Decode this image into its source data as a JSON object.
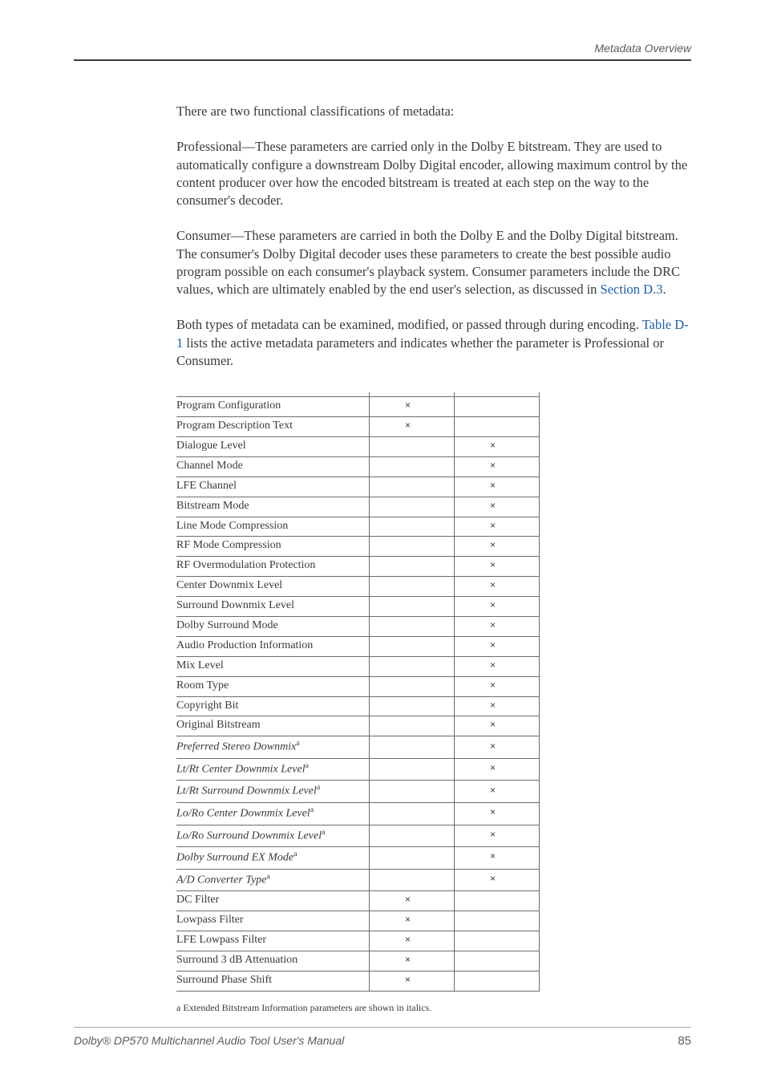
{
  "header_right": "Metadata Overview",
  "p1": "There are two functional classifications of metadata:",
  "p2": "Professional—These parameters are carried only in the Dolby E bitstream. They are used to automatically configure a downstream Dolby Digital encoder, allowing maximum control by the content producer over how the encoded bitstream is treated at each step on the way to the consumer's decoder.",
  "p3": "Consumer—These parameters are carried in both the Dolby E and the Dolby Digital bitstream. The consumer's Dolby Digital decoder uses these parameters to create the best possible audio program possible on each consumer's playback system. Consumer parameters include the DRC values, which are ultimately enabled by the end user's selection, as discussed in ",
  "p3_link": "Section D.3",
  "p3_tail": ".",
  "p4a": "Both types of metadata can be examined, modified, or passed through during encoding. ",
  "p4_link": "Table D-1",
  "p4b": " lists the active metadata parameters and indicates whether the parameter is Professional or Consumer.",
  "rows": [
    {
      "name": "Program Configuration",
      "italic": false,
      "sup": false,
      "pro": true,
      "con": false
    },
    {
      "name": "Program Description Text",
      "italic": false,
      "sup": false,
      "pro": true,
      "con": false
    },
    {
      "name": "Dialogue Level",
      "italic": false,
      "sup": false,
      "pro": false,
      "con": true
    },
    {
      "name": "Channel Mode",
      "italic": false,
      "sup": false,
      "pro": false,
      "con": true
    },
    {
      "name": "LFE Channel",
      "italic": false,
      "sup": false,
      "pro": false,
      "con": true
    },
    {
      "name": "Bitstream Mode",
      "italic": false,
      "sup": false,
      "pro": false,
      "con": true
    },
    {
      "name": "Line Mode Compression",
      "italic": false,
      "sup": false,
      "pro": false,
      "con": true
    },
    {
      "name": "RF Mode Compression",
      "italic": false,
      "sup": false,
      "pro": false,
      "con": true
    },
    {
      "name": "RF Overmodulation Protection",
      "italic": false,
      "sup": false,
      "pro": false,
      "con": true
    },
    {
      "name": "Center Downmix Level",
      "italic": false,
      "sup": false,
      "pro": false,
      "con": true
    },
    {
      "name": "Surround Downmix Level",
      "italic": false,
      "sup": false,
      "pro": false,
      "con": true
    },
    {
      "name": "Dolby Surround Mode",
      "italic": false,
      "sup": false,
      "pro": false,
      "con": true
    },
    {
      "name": "Audio Production Information",
      "italic": false,
      "sup": false,
      "pro": false,
      "con": true
    },
    {
      "name": "Mix Level",
      "italic": false,
      "sup": false,
      "pro": false,
      "con": true
    },
    {
      "name": "Room Type",
      "italic": false,
      "sup": false,
      "pro": false,
      "con": true
    },
    {
      "name": "Copyright Bit",
      "italic": false,
      "sup": false,
      "pro": false,
      "con": true
    },
    {
      "name": "Original Bitstream",
      "italic": false,
      "sup": false,
      "pro": false,
      "con": true
    },
    {
      "name": "Preferred Stereo Downmix",
      "italic": true,
      "sup": true,
      "pro": false,
      "con": true
    },
    {
      "name": "Lt/Rt Center Downmix Level",
      "italic": true,
      "sup": true,
      "pro": false,
      "con": true
    },
    {
      "name": "Lt/Rt Surround Downmix Level",
      "italic": true,
      "sup": true,
      "pro": false,
      "con": true
    },
    {
      "name": "Lo/Ro Center Downmix Level",
      "italic": true,
      "sup": true,
      "pro": false,
      "con": true
    },
    {
      "name": "Lo/Ro Surround Downmix Level",
      "italic": true,
      "sup": true,
      "pro": false,
      "con": true
    },
    {
      "name": "Dolby Surround EX Mode",
      "italic": true,
      "sup": true,
      "pro": false,
      "con": true
    },
    {
      "name": "A/D Converter Type",
      "italic": true,
      "sup": true,
      "pro": false,
      "con": true
    },
    {
      "name": "DC Filter",
      "italic": false,
      "sup": false,
      "pro": true,
      "con": false
    },
    {
      "name": "Lowpass Filter",
      "italic": false,
      "sup": false,
      "pro": true,
      "con": false
    },
    {
      "name": "LFE Lowpass Filter",
      "italic": false,
      "sup": false,
      "pro": true,
      "con": false
    },
    {
      "name": "Surround 3 dB Attenuation",
      "italic": false,
      "sup": false,
      "pro": true,
      "con": false
    },
    {
      "name": "Surround Phase Shift",
      "italic": false,
      "sup": false,
      "pro": true,
      "con": false
    }
  ],
  "footnote": "a  Extended Bitstream Information parameters are shown in italics.",
  "footer_title": "Dolby® DP570 Multichannel Audio Tool User's Manual",
  "page_number": "85"
}
